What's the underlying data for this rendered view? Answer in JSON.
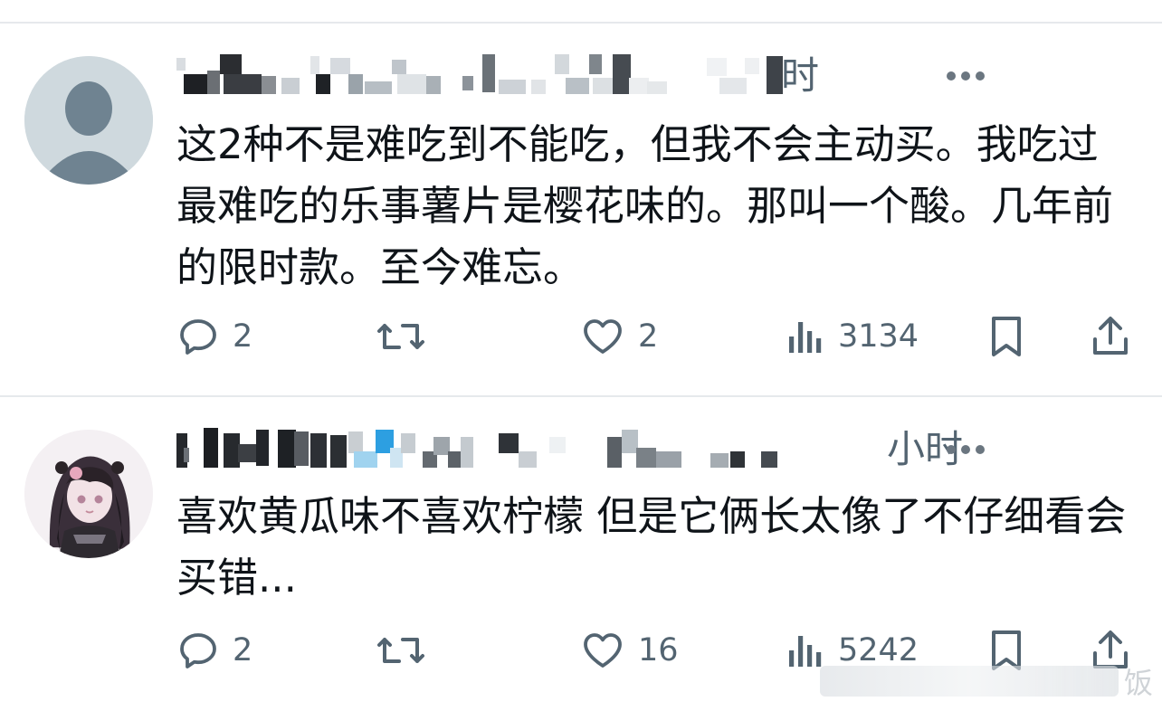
{
  "replies": [
    {
      "time": "时",
      "text": "这2种不是难吃到不能吃，但我不会主动买。我吃过最难吃的乐事薯片是樱花味的。那叫一个酸。几年前的限时款。至今难忘。",
      "reply_count": "2",
      "retweet_count": "",
      "like_count": "2",
      "view_count": "3134"
    },
    {
      "time": "小时",
      "text": "喜欢黄瓜味不喜欢柠檬 但是它俩长太像了不仔细看会买错...",
      "reply_count": "2",
      "retweet_count": "",
      "like_count": "16",
      "view_count": "5242"
    }
  ],
  "watermark": {
    "text": "饭"
  },
  "icons": {
    "reply": "reply-icon",
    "retweet": "retweet-icon",
    "like": "heart-icon",
    "views": "views-icon",
    "bookmark": "bookmark-icon",
    "share": "share-icon",
    "more": "more-icon"
  },
  "colors": {
    "text": "#0f1419",
    "muted": "#536471",
    "divider": "#e6e9ec",
    "avatar_default": "#cfd9de",
    "avatar_silhouette": "#6f8391"
  }
}
